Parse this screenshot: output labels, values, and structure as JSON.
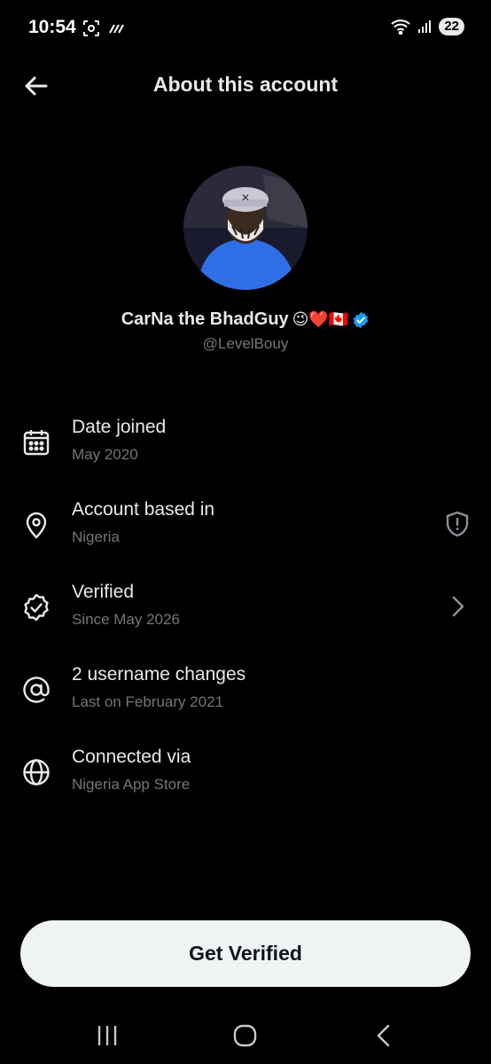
{
  "status_bar": {
    "time": "10:54",
    "battery": "22",
    "icons_left": [
      "screenshot-icon",
      "nfc-icon"
    ],
    "icons_right": [
      "wifi-icon",
      "signal-icon",
      "battery-icon"
    ]
  },
  "header": {
    "title": "About this account",
    "back_icon": "arrow-left-icon"
  },
  "profile": {
    "display_name": "CarNa the BhadGuy",
    "name_emojis": "😉❤️🇨🇦",
    "handle": "@LevelBouy",
    "verified_badge_color": "#1d9bf0",
    "avatar_icon": "profile-photo"
  },
  "info_rows": [
    {
      "icon": "calendar-icon",
      "title": "Date joined",
      "subtitle": "May 2020",
      "trailing": null
    },
    {
      "icon": "location-pin-icon",
      "title": "Account based in",
      "subtitle": "Nigeria",
      "trailing": "shield-alert-icon"
    },
    {
      "icon": "verified-badge-outline-icon",
      "title": "Verified",
      "subtitle": "Since May 2026",
      "trailing": "chevron-right-icon"
    },
    {
      "icon": "at-sign-icon",
      "title": "2 username changes",
      "subtitle": "Last on February 2021",
      "trailing": null
    },
    {
      "icon": "globe-icon",
      "title": "Connected via",
      "subtitle": "Nigeria App Store",
      "trailing": null
    }
  ],
  "cta": {
    "label": "Get Verified"
  },
  "nav_bar": {
    "icons": [
      "recent-apps-icon",
      "home-icon",
      "back-icon"
    ]
  },
  "colors": {
    "background": "#000000",
    "primary_text": "#e7e9ea",
    "secondary_text": "#71767b",
    "button_bg": "#eff3f4",
    "button_text": "#0f1419"
  }
}
